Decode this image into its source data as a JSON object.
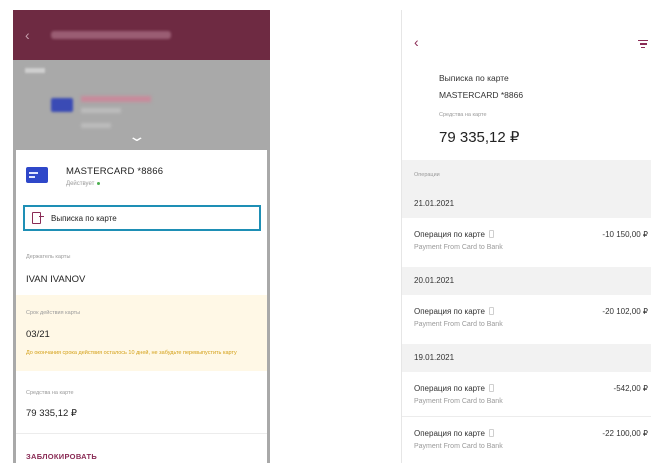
{
  "left": {
    "card_name": "MASTERCARD *8866",
    "card_status": "Действует",
    "statement_button": "Выписка по карте",
    "holder_label": "Держатель карты",
    "holder": "IVAN IVANOV",
    "expiry_label": "Срок действия карты",
    "expiry": "03/21",
    "expiry_warning": "До окончания срока действия осталось 10 дней, не забудьте перевыпустить карту",
    "balance_label": "Средства на карте",
    "balance": "79 335,12 ₽",
    "block_button": "ЗАБЛОКИРОВАТЬ"
  },
  "right": {
    "title_line1": "Выписка по карте",
    "title_line2": "MASTERCARD *8866",
    "balance_label": "Средства на карте",
    "balance": "79 335,12 ₽",
    "operations_label": "Операции",
    "groups": [
      {
        "date": "21.01.2021",
        "title": "Операция по карте",
        "subtitle": "Payment From Card to Bank",
        "amount": "-10 150,00 ₽"
      },
      {
        "date": "20.01.2021",
        "title": "Операция по карте",
        "subtitle": "Payment From Card to Bank",
        "amount": "-20 102,00 ₽"
      },
      {
        "date": "19.01.2021",
        "title": "Операция по карте",
        "subtitle": "Payment From Card to Bank",
        "amount": "-542,00 ₽"
      },
      {
        "title": "Операция по карте",
        "subtitle": "Payment From Card to Bank",
        "amount": "-22 100,00 ₽"
      }
    ]
  },
  "colors": {
    "brand": "#8a2b55",
    "highlight_border": "#1e8fb5",
    "warning": "#d4a017",
    "card_blue": "#2e47c9"
  },
  "icons": [
    "back-arrow-icon",
    "filter-icon",
    "card-icon",
    "statement-icon",
    "receipt-icon"
  ]
}
